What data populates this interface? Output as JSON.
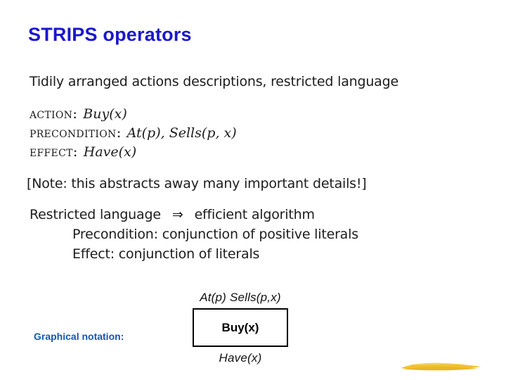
{
  "slide": {
    "title": "STRIPS operators",
    "background_color": "#ffffff",
    "title_color": "#1a18cc",
    "accent_color": "#1557b0",
    "brush_color": "#f2c12e"
  },
  "body": {
    "lead": "Tidily arranged actions descriptions, restricted language",
    "note": "[Note: this abstracts away many important details!]"
  },
  "schema": {
    "rows": [
      {
        "label": "Action:",
        "value": "Buy(x)"
      },
      {
        "label": "Precondition:",
        "value": "At(p), Sells(p, x)"
      },
      {
        "label": "Effect:",
        "value": "Have(x)"
      }
    ]
  },
  "restricted": {
    "head_left": "Restricted language",
    "arrow": "⇒",
    "head_right": "efficient algorithm",
    "sub1": "Precondition: conjunction of positive literals",
    "sub2": "Effect: conjunction of literals"
  },
  "graphical": {
    "label": "Graphical notation:",
    "precondition": "At(p)  Sells(p,x)",
    "action": "Buy(x)",
    "effect": "Have(x)"
  }
}
